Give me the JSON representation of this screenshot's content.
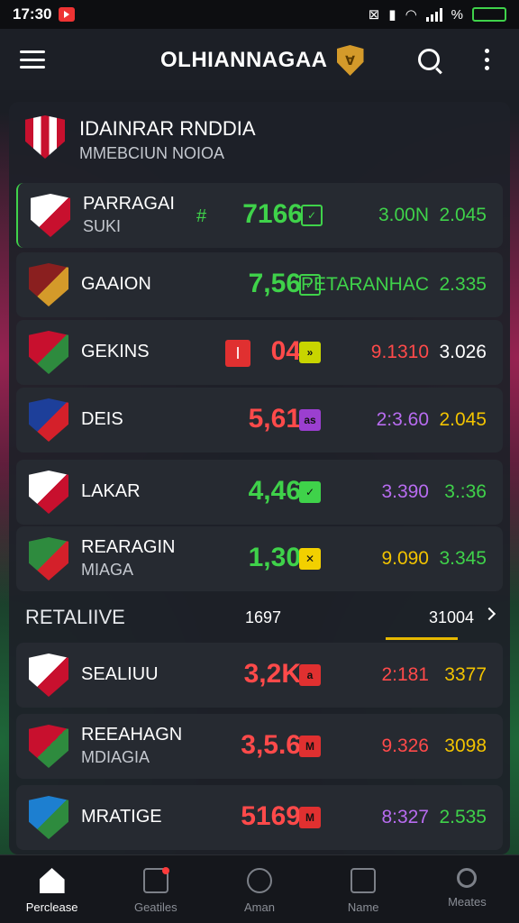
{
  "status_bar": {
    "time": "17:30",
    "battery": "",
    "signal": "%"
  },
  "app_bar": {
    "title": "OLHIANNAGAA"
  },
  "league": {
    "name": "IDAINRAR RNDDIA",
    "subtitle": "MMEBCIUN NOIOA"
  },
  "rows": [
    {
      "name": "PARRAGAI",
      "sub": "SUKI",
      "prefix": "#",
      "score": "7166",
      "score_color": "#3fd24a",
      "mark": "✓",
      "mark_color": "#3fd24a",
      "mark_style": "outline",
      "odd1": "3.00N",
      "odd1_color": "#3fd24a",
      "odd2": "2.045",
      "odd2_color": "#3fd24a",
      "crest_colors": [
        "#ffffff",
        "#c8102e"
      ],
      "active": true
    },
    {
      "name": "GAAION",
      "sub": "",
      "prefix": "",
      "score": "7,56",
      "score_color": "#3fd24a",
      "mark": "✓",
      "mark_color": "#3fd24a",
      "mark_style": "outline",
      "odd1": "PETARANHAC",
      "odd1_color": "#3fd24a",
      "odd2": "2.335",
      "odd2_color": "#3fd24a",
      "crest_colors": [
        "#8a1f1f",
        "#d49a2a"
      ],
      "active": false
    },
    {
      "name": "GEKINS",
      "sub": "",
      "prefix": "",
      "score": "04",
      "score_color": "#ff4a4a",
      "score_badge": "I",
      "mark": "»",
      "mark_color": "#c8d400",
      "mark_style": "filled",
      "odd1": "9.1310",
      "odd1_color": "#ff4a4a",
      "odd2": "3.026",
      "odd2_color": "#ffffff",
      "crest_colors": [
        "#c8102e",
        "#2e8b3e"
      ],
      "active": false
    },
    {
      "name": "DEIS",
      "sub": "",
      "prefix": "",
      "score": "5,61",
      "score_color": "#ff4a4a",
      "mark": "as",
      "mark_color": "#9b3fd0",
      "mark_style": "filled",
      "odd1": "2:3.60",
      "odd1_color": "#b86cf0",
      "odd2": "2.045",
      "odd2_color": "#f2c300",
      "crest_colors": [
        "#1d3f9a",
        "#d4202a"
      ],
      "active": false
    },
    {
      "name": "LAKAR",
      "sub": "",
      "prefix": "",
      "score": "4,46",
      "score_color": "#3fd24a",
      "mark": "✓",
      "mark_color": "#3fd24a",
      "mark_style": "filled",
      "odd1": "3.390",
      "odd1_color": "#b86cf0",
      "odd2": "3.:36",
      "odd2_color": "#3fd24a",
      "crest_colors": [
        "#ffffff",
        "#c8102e"
      ],
      "active": false
    },
    {
      "name": "REARAGIN",
      "sub": "MIAGA",
      "prefix": "",
      "score": "1,30",
      "score_color": "#3fd24a",
      "mark": "✕",
      "mark_color": "#f2d000",
      "mark_style": "filled",
      "odd1": "9.090",
      "odd1_color": "#f2c300",
      "odd2": "3.345",
      "odd2_color": "#3fd24a",
      "crest_colors": [
        "#2e8b3e",
        "#d4202a"
      ],
      "active": false
    }
  ],
  "section": {
    "title": "RETALIIVE",
    "mid": "1697",
    "right": "31004"
  },
  "rows2": [
    {
      "name": "SEALIUU",
      "sub": "",
      "score": "3,2K",
      "score_color": "#ff4a4a",
      "mark": "a",
      "mark_color": "#e03030",
      "odd1": "2:181",
      "odd1_color": "#ff4a4a",
      "odd2": "3377",
      "odd2_color": "#f2c300",
      "crest_colors": [
        "#ffffff",
        "#c8102e"
      ]
    },
    {
      "name": "REEAHAGN",
      "sub": "MDIAGIA",
      "score": "3,5.6",
      "score_color": "#ff4a4a",
      "mark": "M",
      "mark_color": "#e03030",
      "odd1": "9.326",
      "odd1_color": "#ff4a4a",
      "odd2": "3098",
      "odd2_color": "#f2c300",
      "crest_colors": [
        "#c8102e",
        "#2e8b3e"
      ]
    },
    {
      "name": "MRATIGE",
      "sub": "",
      "score": "5169",
      "score_color": "#ff4a4a",
      "mark": "M",
      "mark_color": "#e03030",
      "odd1": "8:327",
      "odd1_color": "#b86cf0",
      "odd2": "2.535",
      "odd2_color": "#3fd24a",
      "crest_colors": [
        "#1d7fd0",
        "#2e8b3e"
      ]
    }
  ],
  "bottom_nav": [
    {
      "label": "Perclease",
      "icon": "home-icon",
      "active": true
    },
    {
      "label": "Geatiles",
      "icon": "notification-icon",
      "active": false
    },
    {
      "label": "Aman",
      "icon": "compass-icon",
      "active": false
    },
    {
      "label": "Name",
      "icon": "flag-icon",
      "active": false
    },
    {
      "label": "Meates",
      "icon": "search-icon",
      "active": false
    }
  ]
}
